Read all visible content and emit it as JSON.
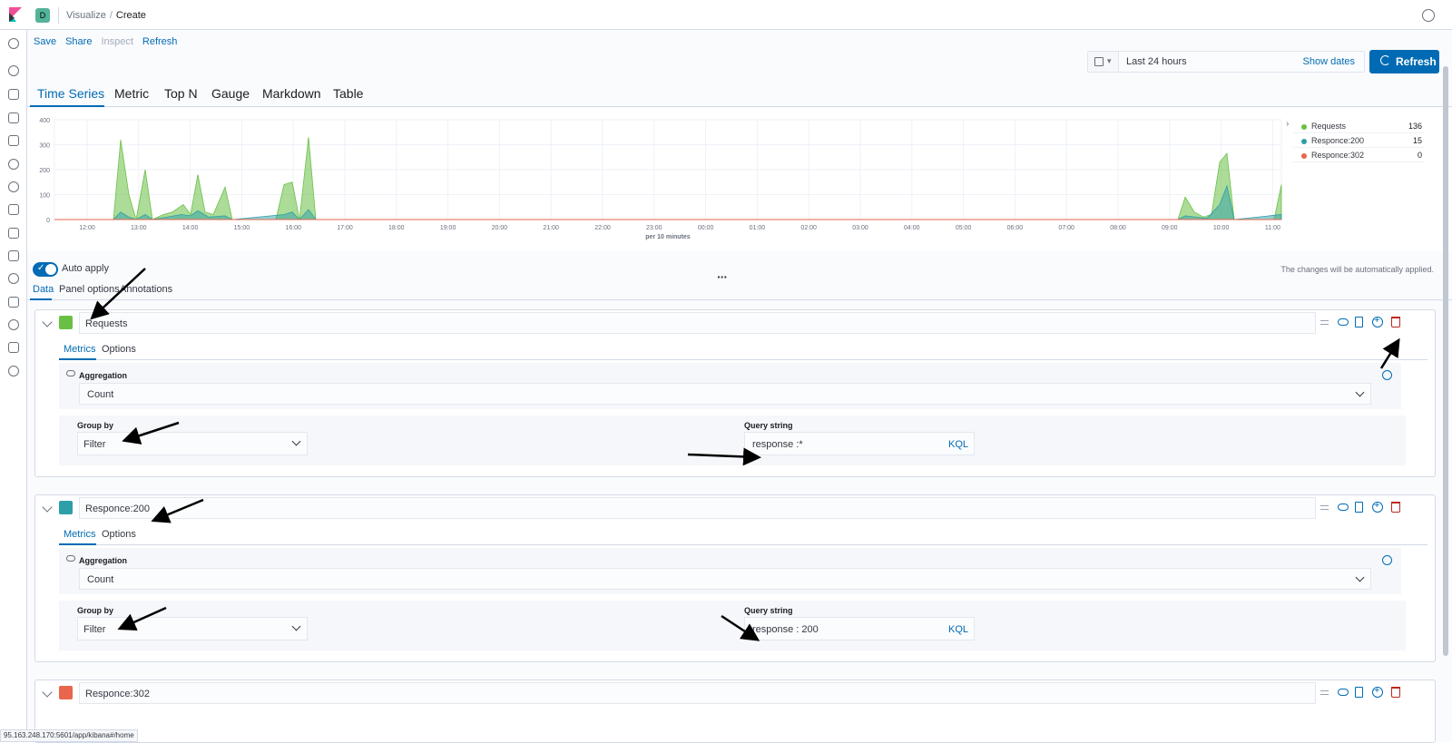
{
  "topbar": {
    "space_initial": "D",
    "breadcrumbs": [
      "Visualize",
      "Create"
    ]
  },
  "menu": {
    "items": [
      "Save",
      "Share",
      "Inspect",
      "Refresh"
    ]
  },
  "datepicker": {
    "range": "Last 24 hours",
    "show_dates": "Show dates"
  },
  "refresh_button": "Refresh",
  "type_tabs": [
    "Time Series",
    "Metric",
    "Top N",
    "Gauge",
    "Markdown",
    "Table"
  ],
  "chart_data": {
    "type": "area",
    "xlabel": "per 10 minutes",
    "ylim": [
      0,
      400
    ],
    "yticks": [
      "400",
      "300",
      "200",
      "100",
      "0"
    ],
    "xticks": [
      "12:00",
      "13:00",
      "14:00",
      "15:00",
      "16:00",
      "17:00",
      "18:00",
      "19:00",
      "20:00",
      "21:00",
      "22:00",
      "23:00",
      "00:00",
      "01:00",
      "02:00",
      "03:00",
      "04:00",
      "05:00",
      "06:00",
      "07:00",
      "08:00",
      "09:00",
      "10:00",
      "11:00"
    ],
    "grid": true,
    "legend_position": "right",
    "series": [
      {
        "name": "Requests",
        "color": "#6ac045",
        "last_value": "136"
      },
      {
        "name": "Responce:200",
        "color": "#2e9ea8",
        "last_value": "15"
      },
      {
        "name": "Responce:302",
        "color": "#e7664c",
        "last_value": "0"
      }
    ]
  },
  "options": {
    "auto_apply": "Auto apply",
    "note": "The changes will be automatically applied."
  },
  "editor_tabs": [
    "Data",
    "Panel options",
    "Annotations"
  ],
  "series_editors": [
    {
      "label": "Requests",
      "color": "#6ac045",
      "subtabs": [
        "Metrics",
        "Options"
      ],
      "aggregation_title": "Aggregation",
      "aggregation": "Count",
      "group_by_title": "Group by",
      "group_by": "Filter",
      "query_title": "Query string",
      "query": "response :*",
      "query_lang": "KQL"
    },
    {
      "label": "Responce:200",
      "color": "#2e9ea8",
      "subtabs": [
        "Metrics",
        "Options"
      ],
      "aggregation_title": "Aggregation",
      "aggregation": "Count",
      "group_by_title": "Group by",
      "group_by": "Filter",
      "query_title": "Query string",
      "query": "response : 200",
      "query_lang": "KQL"
    },
    {
      "label": "Responce:302",
      "color": "#e7664c"
    }
  ],
  "status_url": "95.163.248.170:5601/app/kibana#/home"
}
